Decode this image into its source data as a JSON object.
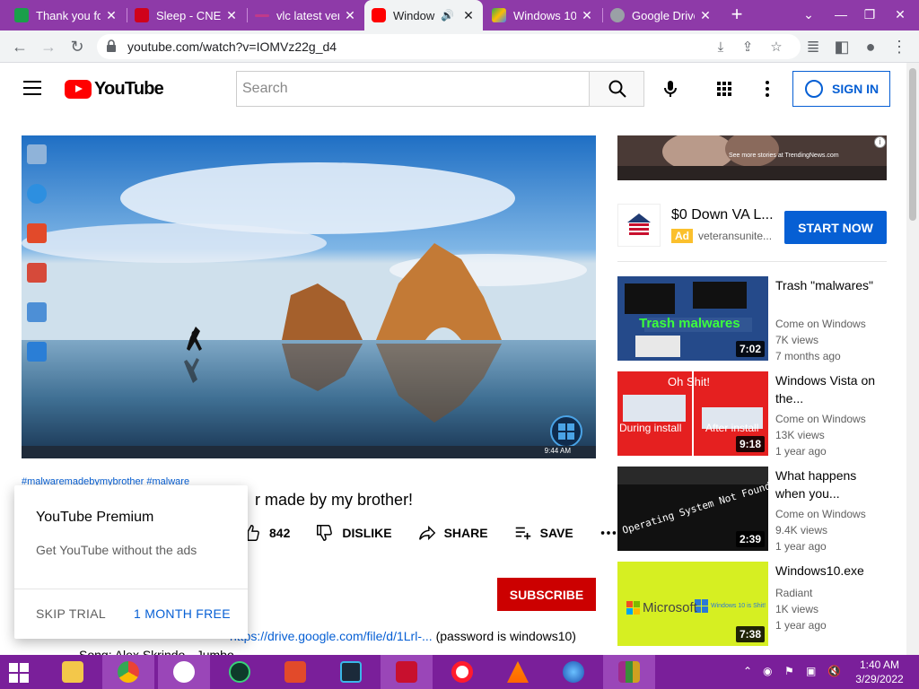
{
  "browser": {
    "tabs": [
      {
        "title": "Thank you fo",
        "favicon_color": "#1a9f4a",
        "active": false
      },
      {
        "title": "Sleep - CNET",
        "favicon_color": "#d0021b",
        "active": false
      },
      {
        "title": "vlc latest ver",
        "favicon_color": "#c03a8a",
        "active": false
      },
      {
        "title": "Window",
        "favicon_color": "#ff0000",
        "active": true
      },
      {
        "title": "Windows 10",
        "favicon_color": "#4285f4",
        "active": false
      },
      {
        "title": "Google Drive",
        "favicon_color": "#9aa0a6",
        "active": false
      }
    ],
    "new_tab_label": "+",
    "url": "youtube.com/watch?v=IOMVz22g_d4"
  },
  "youtube": {
    "logo_text": "YouTube",
    "search_placeholder": "Search",
    "signin_label": "SIGN IN",
    "brand_red": "#ff0000",
    "link_blue": "#065fd4"
  },
  "video": {
    "hashtags": "#malwaremadebymybrother #malware",
    "title_visible": "r made by my brother!",
    "like_count": "842",
    "dislike_label": "DISLIKE",
    "share_label": "SHARE",
    "save_label": "SAVE",
    "subscribe_label": "SUBSCRIBE",
    "description_link": "https://drive.google.com/file/d/1Lrl-...",
    "description_suffix": "(password is windows10)",
    "description_line2": "Song: Alex Skrindo - Jumbo",
    "desktop_taskbar_time": "9:44 AM"
  },
  "premium_popup": {
    "title": "YouTube Premium",
    "subtitle": "Get YouTube without the ads",
    "skip_label": "SKIP TRIAL",
    "free_label": "1 MONTH FREE"
  },
  "ad": {
    "banner_caption": "See more stories at TrendingNews.com",
    "title": "$0 Down VA L...",
    "badge": "Ad",
    "domain": "veteransunite...",
    "cta": "START NOW"
  },
  "recommendations": [
    {
      "title": "Trash \"malwares\"",
      "channel": "Come on Windows",
      "views": "7K views",
      "age": "7 months ago",
      "duration": "7:02",
      "thumb_text": "Trash malwares"
    },
    {
      "title": "Windows Vista on the...",
      "channel": "Come on Windows",
      "views": "13K views",
      "age": "1 year ago",
      "duration": "9:18",
      "thumb_text": "Oh Shit!",
      "thumb_text2": "During install",
      "thumb_text3": "After install"
    },
    {
      "title": "What happens when you...",
      "channel": "Come on Windows",
      "views": "9.4K views",
      "age": "1 year ago",
      "duration": "2:39",
      "thumb_text": "Operating System Not Found"
    },
    {
      "title": "Windows10.exe",
      "channel": "Radiant",
      "views": "1K views",
      "age": "1 year ago",
      "duration": "7:38",
      "thumb_text": "Microsoft",
      "thumb_text2": "Windows 10 is Shit!"
    }
  ],
  "os_taskbar": {
    "time": "1:40 AM",
    "date": "3/29/2022"
  }
}
